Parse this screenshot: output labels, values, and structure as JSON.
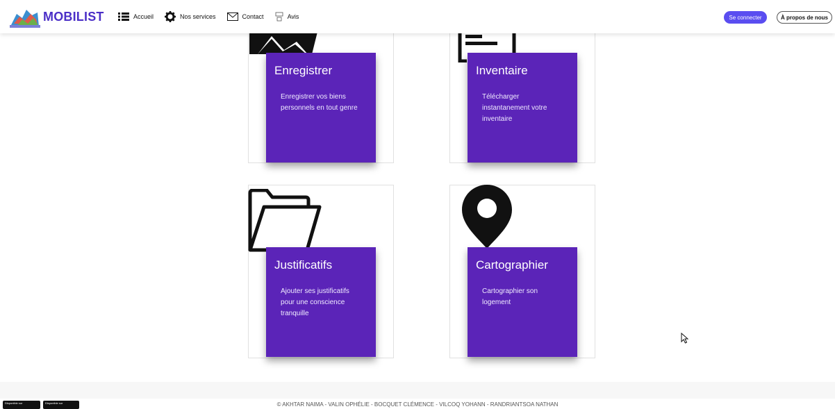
{
  "header": {
    "brand": "MOBILIST",
    "nav": [
      {
        "label": "Accueil",
        "icon": "list-icon"
      },
      {
        "label": "Nos services",
        "icon": "gear-icon"
      },
      {
        "label": "Contact",
        "icon": "envelope-icon"
      },
      {
        "label": "Avis",
        "icon": "review-icon"
      }
    ],
    "login_label": "Se connecter",
    "about_label": "À propos de nous"
  },
  "cards": [
    {
      "title": "Enregistrer",
      "description": "Enregistrer vos biens personnels en tout genre",
      "icon": "register-icon"
    },
    {
      "title": "Inventaire",
      "description": "Télécharger instantanement votre inventaire",
      "icon": "inventory-icon"
    },
    {
      "title": "Justificatifs",
      "description": "Ajouter ses justificatifs pour une conscience tranquille",
      "icon": "folder-icon"
    },
    {
      "title": "Cartographier",
      "description": "Cartographier son logement",
      "icon": "map-pin-icon"
    }
  ],
  "footer": {
    "badges": [
      "Disponible sur",
      "Disponible sur"
    ],
    "copyright": "© AKHTAR NAIMA - VALIN OPHÉLIE - BOCQUET CLÉMENCE - VILCOQ YOHANN - RANDRIANTSOA NATHAN"
  },
  "colors": {
    "accent": "#5b24b8",
    "brand": "#4b2fc7",
    "button": "#5a4df0"
  }
}
